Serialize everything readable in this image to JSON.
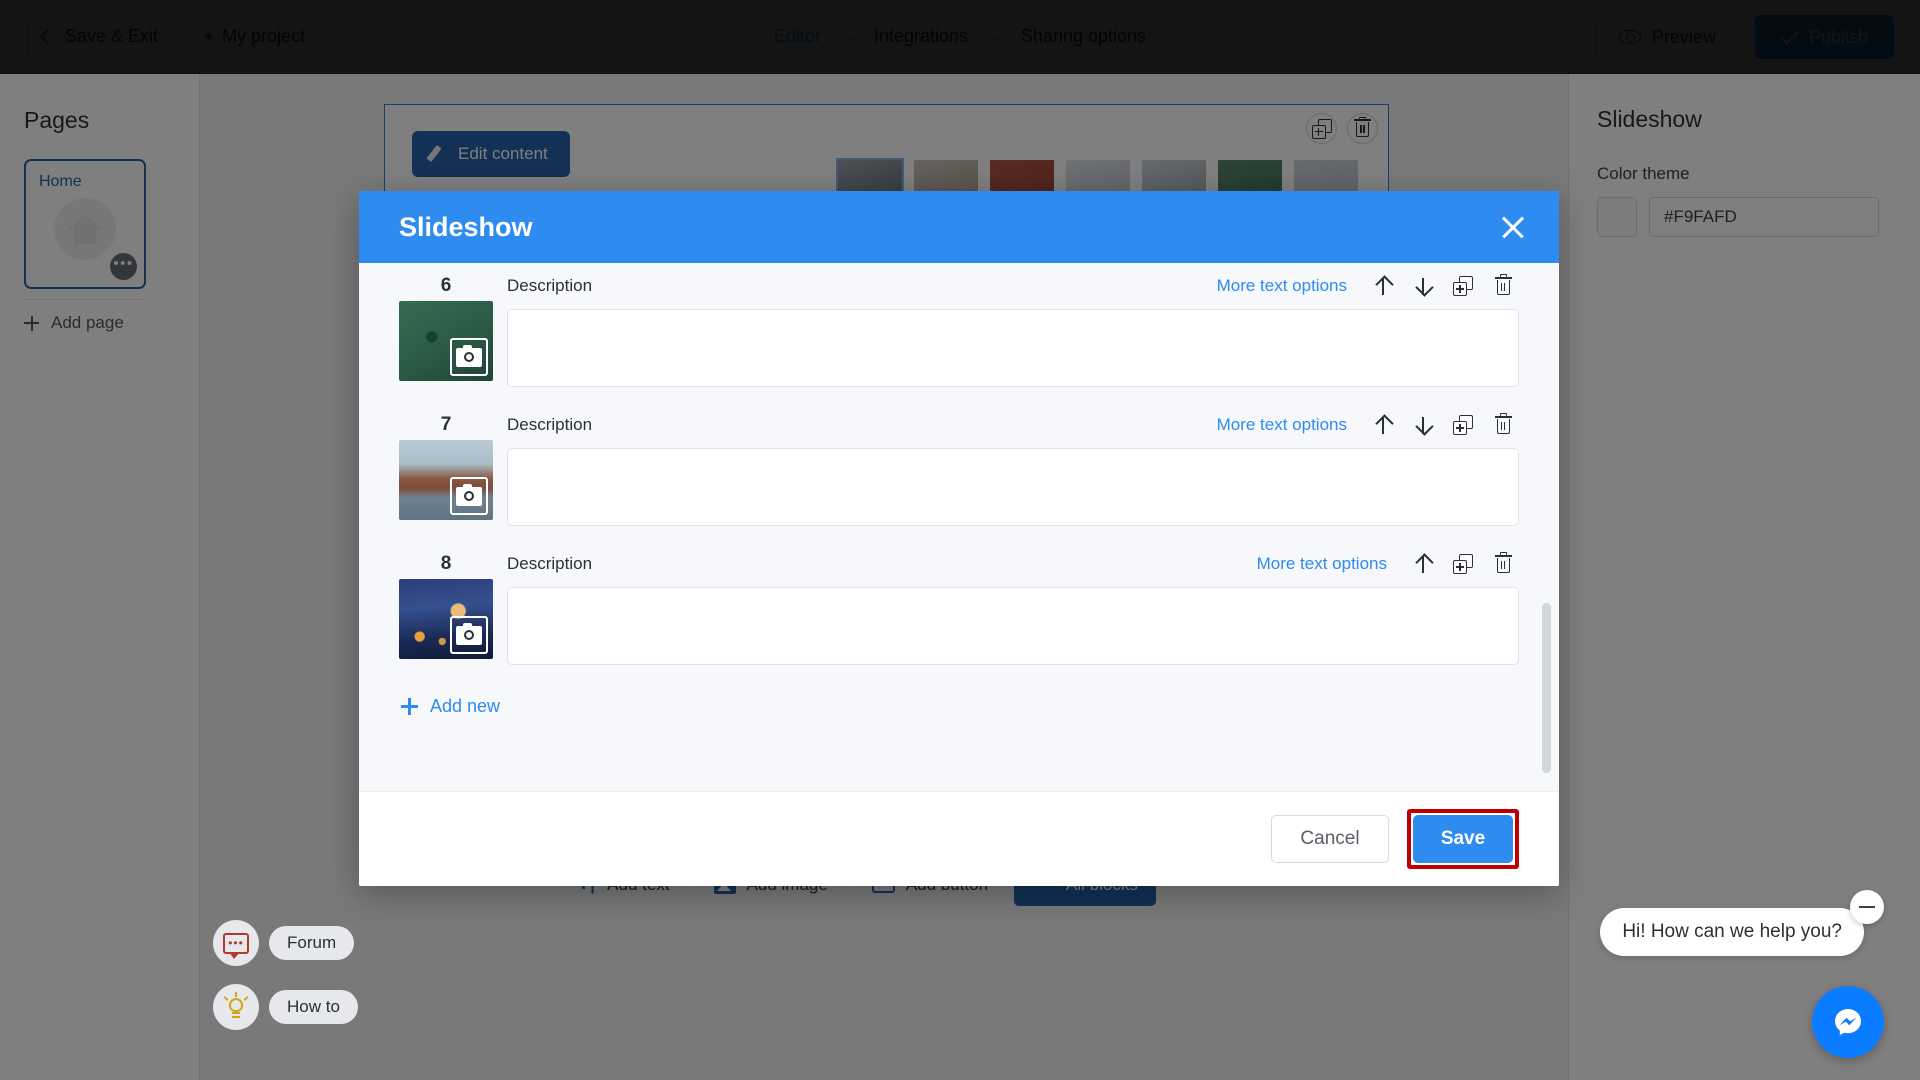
{
  "topbar": {
    "save_exit_label": "Save & Exit",
    "project_name": "My project",
    "breadcrumbs": [
      {
        "label": "Editor",
        "active": true
      },
      {
        "label": "Integrations",
        "active": false
      },
      {
        "label": "Sharing options",
        "active": false
      }
    ],
    "arrow_glyph": "→",
    "preview_label": "Preview",
    "publish_label": "Publish"
  },
  "sidebar_left": {
    "title": "Pages",
    "page_card": {
      "label": "Home",
      "menu_glyph": "•••"
    },
    "add_page_label": "Add page"
  },
  "sidebar_right": {
    "title": "Slideshow",
    "color_theme_label": "Color theme",
    "color_value": "#F9FAFD"
  },
  "canvas": {
    "edit_content_label": "Edit content",
    "toolbar": [
      {
        "label": "Add text",
        "icon": "text-format-icon",
        "primary": false
      },
      {
        "label": "Add image",
        "icon": "image-icon",
        "primary": false
      },
      {
        "label": "Add button",
        "icon": "button-block-icon",
        "primary": false
      },
      {
        "label": "All blocks",
        "icon": "ellipsis-icon",
        "primary": true
      }
    ]
  },
  "helpers": [
    {
      "label": "Forum",
      "icon": "chat-bubble-icon"
    },
    {
      "label": "How to",
      "icon": "lightbulb-icon"
    }
  ],
  "chat": {
    "message": "Hi! How can we help you?",
    "minimize_icon": "minimize-icon",
    "fab_icon": "messenger-icon",
    "fab_color": "#0a7cff"
  },
  "modal": {
    "title": "Slideshow",
    "close_icon": "close-icon",
    "accent_color": "#2e8bf0",
    "description_label": "Description",
    "more_text_options_label": "More text options",
    "add_new_label": "Add new",
    "cancel_label": "Cancel",
    "save_label": "Save",
    "save_highlight_color": "#c00000",
    "slides": [
      {
        "number": "6",
        "description_value": "",
        "thumb_alt": "koi-pond-photo",
        "thumb_colors": [
          "#2f5d47",
          "#3f7a56",
          "#1f4433"
        ],
        "actions": [
          "move-up",
          "move-down",
          "duplicate",
          "delete"
        ]
      },
      {
        "number": "7",
        "description_value": "",
        "thumb_alt": "japanese-temple-photo",
        "thumb_colors": [
          "#9fb8c8",
          "#8d5d4a",
          "#5b7f8d"
        ],
        "actions": [
          "move-up",
          "move-down",
          "duplicate",
          "delete"
        ]
      },
      {
        "number": "8",
        "description_value": "",
        "thumb_alt": "night-cherry-blossom-photo",
        "thumb_colors": [
          "#1b2a55",
          "#3a4d87",
          "#0f1733"
        ],
        "actions": [
          "move-up",
          "duplicate",
          "delete"
        ]
      }
    ]
  }
}
